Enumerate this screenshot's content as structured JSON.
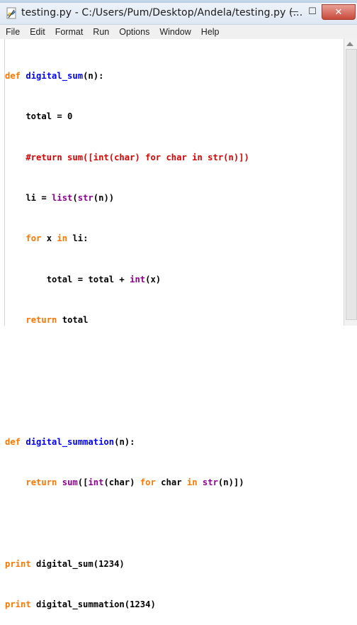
{
  "window": {
    "title": "testing.py - C:/Users/Pum/Desktop/Andela/testing.py (..."
  },
  "menu": [
    "File",
    "Edit",
    "Format",
    "Run",
    "Options",
    "Window",
    "Help"
  ],
  "controls": {
    "minimize": "—",
    "maximize": "☐",
    "close": "✕"
  },
  "colors": {
    "keyword": "#ff7700",
    "function_name": "#0000ff",
    "builtin": "#900090",
    "comment": "#dd0000"
  },
  "code": {
    "l1": {
      "kw": "def",
      "sp": " ",
      "fn": "digital_sum",
      "rest": "(n):"
    },
    "l2": "    total = 0",
    "l3": "    #return sum([int(char) for char in str(n)])",
    "l4": {
      "a": "    li = ",
      "b1": "list",
      "b2": "(",
      "b3": "str",
      "b4": "(n))"
    },
    "l5": {
      "ind": "    ",
      "k1": "for",
      "a": " x ",
      "k2": "in",
      "b": " li:"
    },
    "l6": {
      "a": "        total = total + ",
      "b": "int",
      "c": "(x)"
    },
    "l7": {
      "ind": "    ",
      "k": "return",
      "a": " total"
    },
    "l8": "",
    "l9": "",
    "l10": {
      "kw": "def",
      "sp": " ",
      "fn": "digital_summation",
      "rest": "(n):"
    },
    "l11": {
      "ind": "    ",
      "k1": "return",
      "s": " ",
      "b1": "sum",
      "p1": "([",
      "b2": "int",
      "p2": "(char) ",
      "k2": "for",
      "p3": " char ",
      "k3": "in",
      "s2": " ",
      "b3": "str",
      "p4": "(n)])"
    },
    "l12": "",
    "l13": {
      "k": "print",
      "a": " digital_sum(1234)"
    },
    "l14": {
      "k": "print",
      "a": " digital_summation(1234)"
    }
  }
}
